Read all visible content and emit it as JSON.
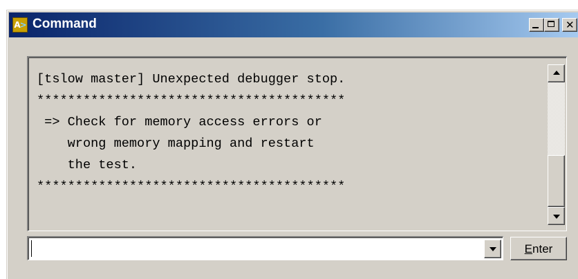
{
  "window": {
    "title": "Command",
    "icon": "app-command-icon",
    "controls": {
      "minimize": "minimize-icon",
      "maximize": "maximize-icon",
      "close": "close-icon"
    },
    "colors": {
      "titlebar_start": "#0a246a",
      "titlebar_end": "#a6caf0",
      "face": "#d4d0c8"
    }
  },
  "output": {
    "lines": [
      "[tslow master] Unexpected debugger stop.",
      "****************************************",
      " => Check for memory access errors or",
      "    wrong memory mapping and restart",
      "    the test.",
      "****************************************"
    ]
  },
  "command_input": {
    "value": ""
  },
  "enter_button": {
    "mnemonic": "E",
    "rest": "nter"
  }
}
